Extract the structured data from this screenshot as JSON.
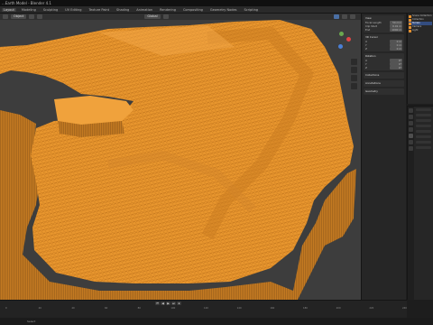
{
  "titlebar": {
    "text": "...Earth Model - Blender 4.1"
  },
  "menubar": {
    "workspaces": [
      "Layout",
      "Modeling",
      "Sculpting",
      "UV Editing",
      "Texture Paint",
      "Shading",
      "Animation",
      "Rendering",
      "Compositing",
      "Geometry Nodes",
      "Scripting"
    ],
    "active_index": 0
  },
  "viewport": {
    "mode_label": "Object",
    "view_label": "Global"
  },
  "npanel": {
    "sections": [
      {
        "title": "View",
        "rows": [
          [
            "Focal Length",
            "50 mm"
          ],
          [
            "Clip Start",
            "0.01 m"
          ],
          [
            "End",
            "1000 m"
          ]
        ]
      },
      {
        "title": "3D Cursor",
        "rows": [
          [
            "X",
            "0 m"
          ],
          [
            "Y",
            "0 m"
          ],
          [
            "Z",
            "0 m"
          ]
        ]
      },
      {
        "title": "Rotation",
        "rows": [
          [
            "X",
            "0°"
          ],
          [
            "Y",
            "0°"
          ],
          [
            "Z",
            "0°"
          ]
        ]
      },
      {
        "title": "Collections",
        "rows": []
      },
      {
        "title": "Annotations",
        "rows": []
      },
      {
        "title": "Geometry",
        "rows": []
      }
    ]
  },
  "outliner": {
    "items": [
      "Scene Collection",
      "Collection",
      "Terrain",
      "Camera",
      "Light"
    ],
    "selected_index": 2
  },
  "timeline": {
    "controls": [
      "⏮",
      "◀",
      "▶",
      "⏭",
      "⏺"
    ],
    "ticks": [
      "0",
      "20",
      "40",
      "60",
      "80",
      "100",
      "120",
      "140",
      "160",
      "180",
      "200",
      "220",
      "240"
    ]
  },
  "statusbar": {
    "text": "Select"
  },
  "colors": {
    "terrain": "#e8962e",
    "terrain_dark": "#8a5514",
    "viewport_bg": "#3d3d3d",
    "accent": "#4a6fa4"
  }
}
